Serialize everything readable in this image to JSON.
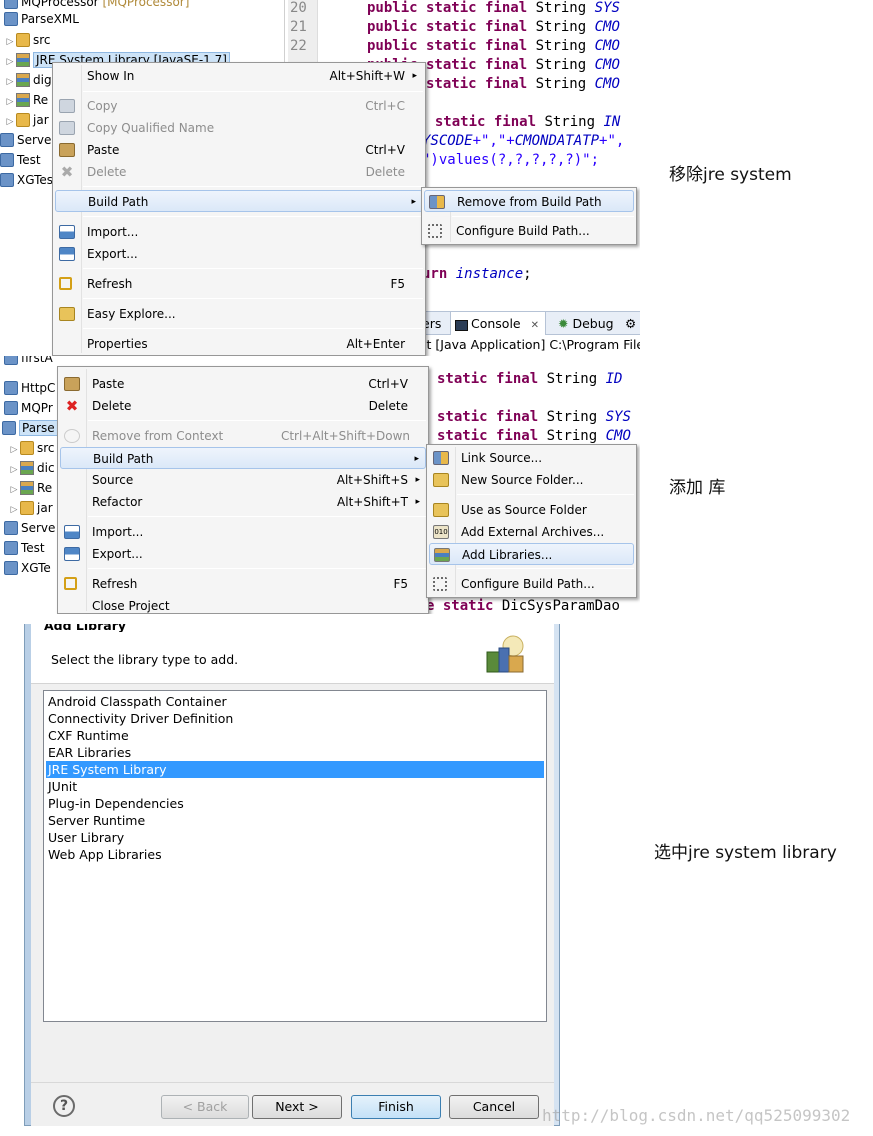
{
  "panel1": {
    "tree": [
      {
        "label": "MQProcessor",
        "suffix": "[MQProcessor]",
        "icon": "project-icon"
      },
      {
        "label": "ParseXML",
        "icon": "project-icon"
      },
      {
        "label": "src",
        "icon": "folder-icon"
      },
      {
        "label": "JRE System Library [JavaSE-1.7]",
        "icon": "library-icon"
      },
      {
        "label": "dig",
        "icon": "library-icon"
      },
      {
        "label": "Re",
        "icon": "library-icon"
      },
      {
        "label": "jar",
        "icon": "folder-icon"
      },
      {
        "label": "Server",
        "icon": "project-icon"
      },
      {
        "label": "Test",
        "icon": "project-icon"
      },
      {
        "label": "XGTes",
        "icon": "project-icon"
      }
    ],
    "line_numbers": [
      "20",
      "21",
      "22"
    ],
    "code": {
      "modifiers": "public static final",
      "type": "String",
      "names": [
        "SYS",
        "CMO",
        "CMO",
        "CMO",
        "CMO"
      ],
      "l_static_final": "e static final",
      "l_string": "String",
      "l_in": "IN",
      "l_syscode": "YSCODE",
      "l_plus_str": "+\",\"+",
      "l_cmondatatp": "CMONDATATP",
      "l_plus_comma": "+\",",
      "l_values": "\")values(?,?,?,?,?)\";",
      "l_return": "urn",
      "l_instance": "instance",
      "l_semicolon": ";"
    },
    "menu": [
      {
        "label": "Show In",
        "key": "Alt+Shift+W",
        "arrow": "▸",
        "icon": ""
      },
      {
        "label": "Copy",
        "key": "Ctrl+C",
        "disabled": true,
        "icon": "copy-icon"
      },
      {
        "label": "Copy Qualified Name",
        "key": "",
        "disabled": true,
        "icon": "copy-icon"
      },
      {
        "label": "Paste",
        "key": "Ctrl+V",
        "icon": "paste-icon"
      },
      {
        "label": "Delete",
        "key": "Delete",
        "disabled": true,
        "icon": "delete-icon"
      },
      {
        "label": "Build Path",
        "key": "",
        "arrow": "▸",
        "highlighted": true,
        "icon": ""
      },
      {
        "label": "Import...",
        "key": "",
        "icon": "import-icon"
      },
      {
        "label": "Export...",
        "key": "",
        "icon": "export-icon"
      },
      {
        "label": "Refresh",
        "key": "F5",
        "icon": "refresh-icon"
      },
      {
        "label": "Easy Explore...",
        "key": "",
        "icon": "folder-icon"
      },
      {
        "label": "Properties",
        "key": "Alt+Enter",
        "icon": ""
      }
    ],
    "submenu": [
      {
        "label": "Remove from Build Path",
        "icon": "build-path-icon",
        "highlighted": true
      },
      {
        "label": "Configure Build Path...",
        "icon": "gear-icon"
      }
    ],
    "tabs": {
      "left": "ers",
      "console": "Console",
      "console_close": "✕",
      "debug": "Debug"
    },
    "console_text": "st [Java Application] C:\\Program File",
    "note": "移除jre system"
  },
  "panel2": {
    "tree": [
      {
        "label": "firstA",
        "icon": "project-icon"
      },
      {
        "label": "HttpC",
        "icon": "project-icon"
      },
      {
        "label": "MQPr",
        "icon": "project-icon"
      },
      {
        "label": "Parse",
        "icon": "project-icon"
      },
      {
        "label": "src",
        "icon": "folder-icon"
      },
      {
        "label": "dic",
        "icon": "library-icon"
      },
      {
        "label": "Re",
        "icon": "library-icon"
      },
      {
        "label": "jar",
        "icon": "folder-icon"
      },
      {
        "label": "Serve",
        "icon": "project-icon"
      },
      {
        "label": "Test",
        "icon": "project-icon"
      },
      {
        "label": "XGTe",
        "icon": "project-icon"
      }
    ],
    "code": {
      "static_final": "static final",
      "string": "String",
      "names": [
        "ID",
        "SYS",
        "CMO"
      ],
      "l_static_final": "e static",
      "l_type": "DicSysParamDao"
    },
    "menu": [
      {
        "label": "Paste",
        "key": "Ctrl+V",
        "icon": "paste-icon"
      },
      {
        "label": "Delete",
        "key": "Delete",
        "icon": "delete-icon"
      },
      {
        "label": "Remove from Context",
        "key": "Ctrl+Alt+Shift+Down",
        "disabled": true,
        "icon": ""
      },
      {
        "label": "Build Path",
        "key": "",
        "arrow": "▸",
        "highlighted": true,
        "icon": ""
      },
      {
        "label": "Source",
        "key": "Alt+Shift+S",
        "arrow": "▸",
        "icon": ""
      },
      {
        "label": "Refactor",
        "key": "Alt+Shift+T",
        "arrow": "▸",
        "icon": ""
      },
      {
        "label": "Import...",
        "key": "",
        "icon": "import-icon"
      },
      {
        "label": "Export...",
        "key": "",
        "icon": "export-icon"
      },
      {
        "label": "Refresh",
        "key": "F5",
        "icon": "refresh-icon"
      },
      {
        "label": "Close Project",
        "key": "",
        "icon": ""
      }
    ],
    "submenu": [
      {
        "label": "Link Source...",
        "icon": "link-icon"
      },
      {
        "label": "New Source Folder...",
        "icon": "folder-icon"
      },
      {
        "label": "Use as Source Folder",
        "icon": "folder-icon"
      },
      {
        "label": "Add External Archives...",
        "icon": "jar-icon"
      },
      {
        "label": "Add Libraries...",
        "icon": "library-icon",
        "highlighted": true
      },
      {
        "label": "Configure Build Path...",
        "icon": "gear-icon"
      }
    ],
    "note": "添加 库"
  },
  "panel3": {
    "dialog_title": "Add Library",
    "instruction": "Select the library type to add.",
    "libraries": [
      "Android Classpath Container",
      "Connectivity Driver Definition",
      "CXF Runtime",
      "EAR Libraries",
      "JRE System Library",
      "JUnit",
      "Plug-in Dependencies",
      "Server Runtime",
      "User Library",
      "Web App Libraries"
    ],
    "selected_index": 4,
    "buttons": {
      "help": "?",
      "back": "< Back",
      "next": "Next >",
      "finish": "Finish",
      "cancel": "Cancel"
    },
    "note": "选中jre system library",
    "watermark": "http://blog.csdn.net/qq525099302"
  },
  "colors": {
    "keyword": "#7f0055",
    "field": "#0000c0",
    "string": "#2a00ff",
    "selection": "#3399ff"
  }
}
